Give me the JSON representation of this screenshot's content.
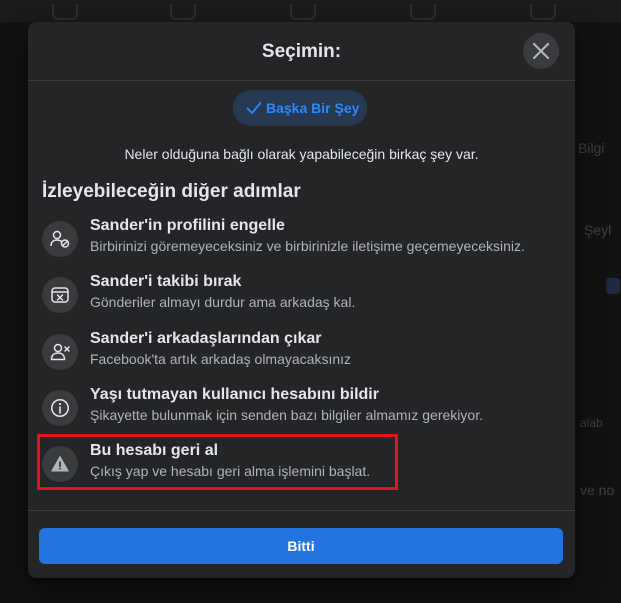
{
  "background": {
    "texts": [
      "Bilgi",
      "Şeyl",
      "alab",
      "ve no"
    ]
  },
  "modal": {
    "title": "Seçimin:",
    "close_icon": "close-icon",
    "choice": {
      "label": "Başka Bir Şey",
      "icon": "check-icon"
    },
    "intro": "Neler olduğuna bağlı olarak yapabileceğin birkaç şey var.",
    "section_title": "İzleyebileceğin diğer adımlar",
    "actions": [
      {
        "title": "Sander'in profilini engelle",
        "description": "Birbirinizi göremeyeceksiniz ve birbirinizle iletişime geçemeyeceksiniz.",
        "icon": "block-user-icon"
      },
      {
        "title": "Sander'i takibi bırak",
        "description": "Gönderiler almayı durdur ama arkadaş kal.",
        "icon": "unfollow-icon"
      },
      {
        "title": "Sander'i arkadaşlarından çıkar",
        "description": "Facebook'ta artık arkadaş olmayacaksınız",
        "icon": "unfriend-icon"
      },
      {
        "title": "Yaşı tutmayan kullanıcı hesabını bildir",
        "description": "Şikayette bulunmak için senden bazı bilgiler almamız gerekiyor.",
        "icon": "info-icon"
      },
      {
        "title": "Bu hesabı geri al",
        "description": "Çıkış yap ve hesabı geri alma işlemini başlat.",
        "icon": "warning-icon"
      }
    ],
    "done_label": "Bitti"
  },
  "colors": {
    "accent": "#2374e1",
    "highlight": "#e4141b",
    "modal_bg": "#242526"
  }
}
